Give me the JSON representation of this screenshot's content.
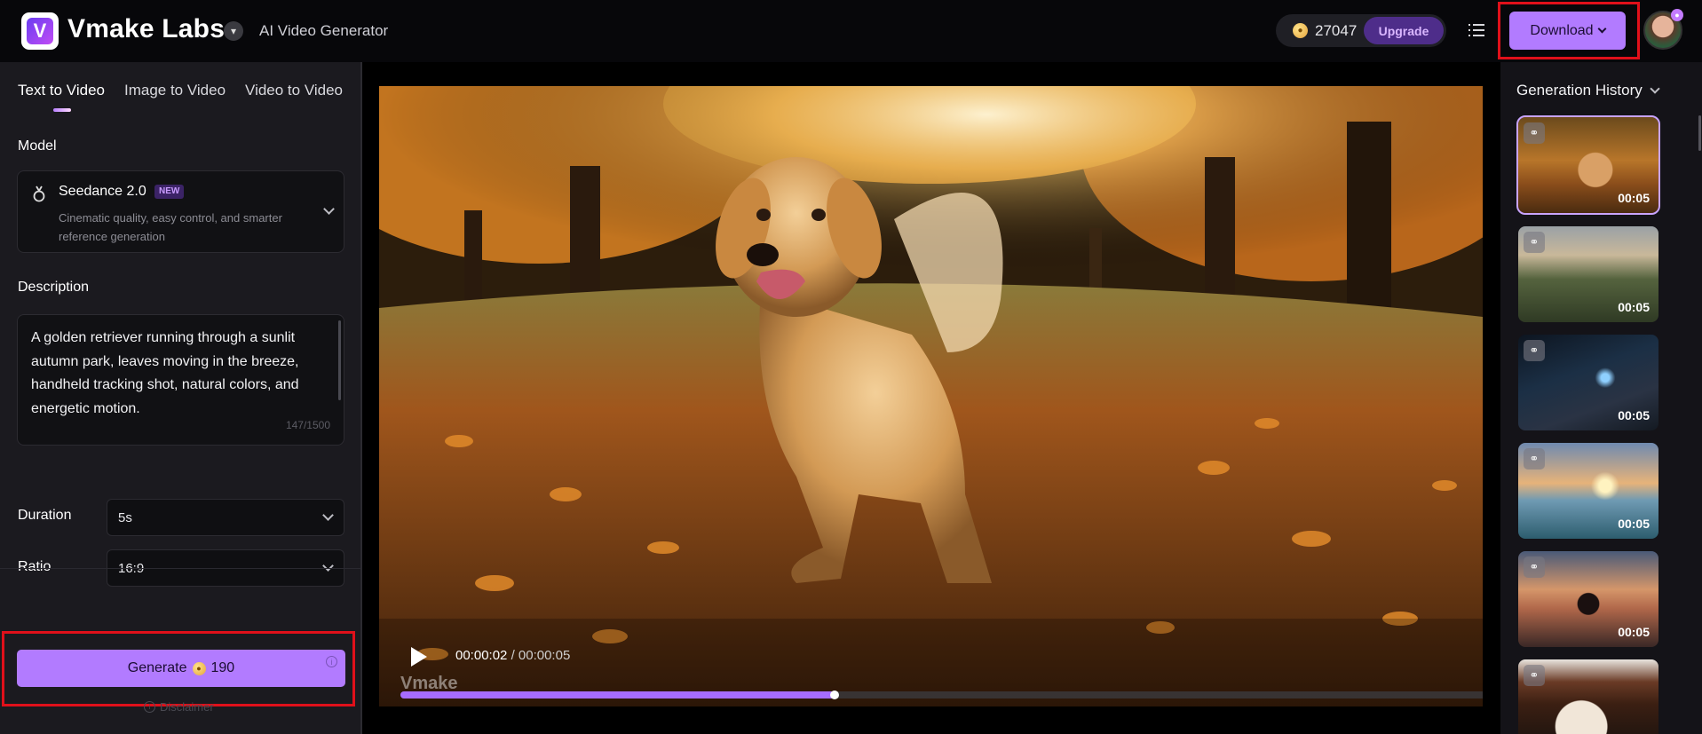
{
  "header": {
    "brand": "Vmake Labs",
    "subtitle": "AI Video Generator",
    "credits": "27047",
    "upgrade_label": "Upgrade",
    "download_label": "Download"
  },
  "left_panel": {
    "tabs": [
      {
        "label": "Text to Video",
        "active": true
      },
      {
        "label": "Image to Video",
        "active": false
      },
      {
        "label": "Video to Video",
        "active": false
      }
    ],
    "model_label": "Model",
    "model": {
      "name": "Seedance 2.0",
      "badge": "NEW",
      "description": "Cinematic quality, easy control, and smarter reference generation"
    },
    "description_label": "Description",
    "description_text": "A golden retriever running through a sunlit autumn park, leaves moving in the breeze, handheld tracking shot, natural colors, and energetic motion.",
    "char_count": "147/1500",
    "duration_label": "Duration",
    "duration_value": "5s",
    "ratio_label": "Ratio",
    "ratio_value": "16:9",
    "generate_label": "Generate",
    "generate_cost": "190",
    "disclaimer": "Disclaimer"
  },
  "player": {
    "current_time": "00:00:02",
    "total_time": "/ 00:00:05",
    "watermark": "Vmake",
    "progress": 0.4
  },
  "history": {
    "title": "Generation History",
    "items": [
      {
        "duration": "00:05",
        "active": true
      },
      {
        "duration": "00:05",
        "active": false
      },
      {
        "duration": "00:05",
        "active": false
      },
      {
        "duration": "00:05",
        "active": false
      },
      {
        "duration": "00:05",
        "active": false
      },
      {
        "duration": "",
        "active": false
      }
    ]
  },
  "colors": {
    "accent": "#b27bff",
    "highlight_box": "#e0101a",
    "panel": "#1b1a1f"
  }
}
